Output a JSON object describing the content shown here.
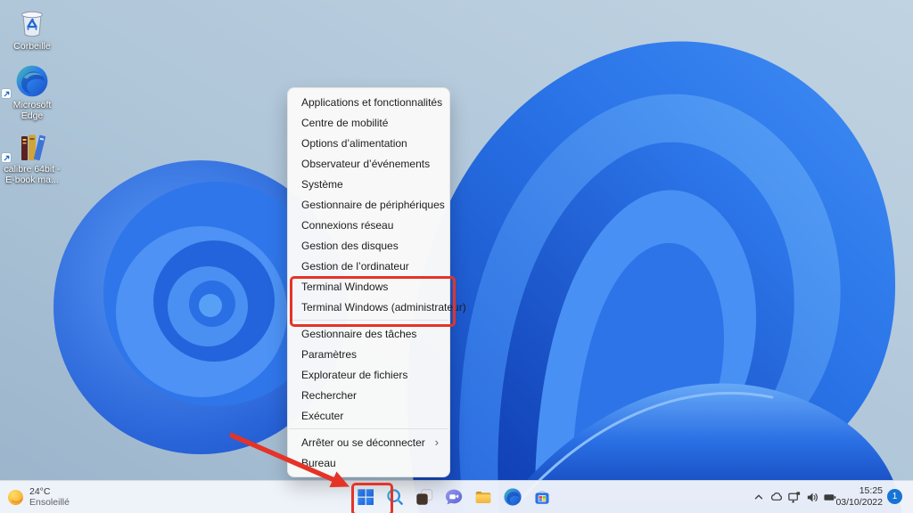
{
  "annotations": {
    "color": "#e53328"
  },
  "desktop_icons": [
    {
      "name": "recycle-bin",
      "label": "Corbeille"
    },
    {
      "name": "microsoft-edge",
      "label": "Microsoft Edge"
    },
    {
      "name": "calibre",
      "label": "calibre 64bit -",
      "label2": "E-book ma..."
    }
  ],
  "context_menu": {
    "submenu_arrow": "›",
    "items": [
      {
        "label": "Applications et fonctionnalités"
      },
      {
        "label": "Centre de mobilité"
      },
      {
        "label": "Options d’alimentation"
      },
      {
        "label": "Observateur d’événements"
      },
      {
        "label": "Système"
      },
      {
        "label": "Gestionnaire de périphériques"
      },
      {
        "label": "Connexions réseau"
      },
      {
        "label": "Gestion des disques"
      },
      {
        "label": "Gestion de l’ordinateur"
      },
      {
        "label": "Terminal Windows",
        "highlighted": true
      },
      {
        "label": "Terminal Windows (administrateur)",
        "highlighted": true
      },
      {
        "label": "Gestionnaire des tâches"
      },
      {
        "label": "Paramètres"
      },
      {
        "label": "Explorateur de fichiers"
      },
      {
        "label": "Rechercher"
      },
      {
        "label": "Exécuter"
      },
      {
        "label": "Arrêter ou se déconnecter",
        "has_submenu": true
      },
      {
        "label": "Bureau"
      }
    ]
  },
  "taskbar": {
    "weather": {
      "temperature": "24°C",
      "condition": "Ensoleillé"
    },
    "buttons": [
      "start",
      "search",
      "task-view",
      "chat",
      "file-explorer",
      "edge",
      "store"
    ],
    "tray_icons": [
      "hidden-icons-chevron",
      "onedrive-cloud",
      "network-display",
      "volume",
      "battery"
    ],
    "clock": {
      "time": "15:25",
      "date": "03/10/2022"
    },
    "notification_count": "1"
  }
}
